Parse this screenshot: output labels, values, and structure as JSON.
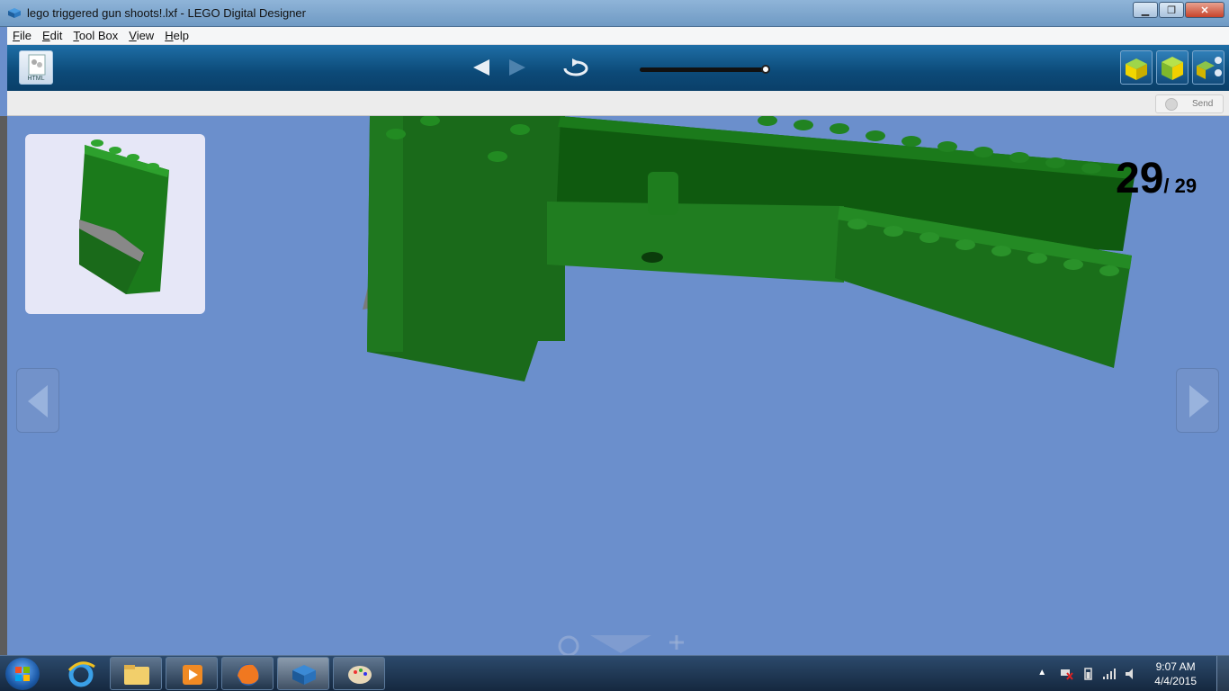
{
  "window": {
    "title": "lego triggered gun shoots!.lxf - LEGO Digital Designer",
    "app_icon": "lego-brick-icon"
  },
  "menu": {
    "items": [
      {
        "label": "File"
      },
      {
        "label": "Edit"
      },
      {
        "label": "Tool Box"
      },
      {
        "label": "View"
      },
      {
        "label": "Help"
      }
    ]
  },
  "toolbar": {
    "html_button_label": "HTML",
    "step_slider_progress": 1.0
  },
  "subbar": {
    "send_label": "Send"
  },
  "viewport": {
    "step_current": "29",
    "step_total": "29",
    "background_color": "#6b8fcc",
    "brick_color": "#1b7a1b"
  },
  "taskbar": {
    "clock_time": "9:07 AM",
    "clock_date": "4/4/2015"
  }
}
